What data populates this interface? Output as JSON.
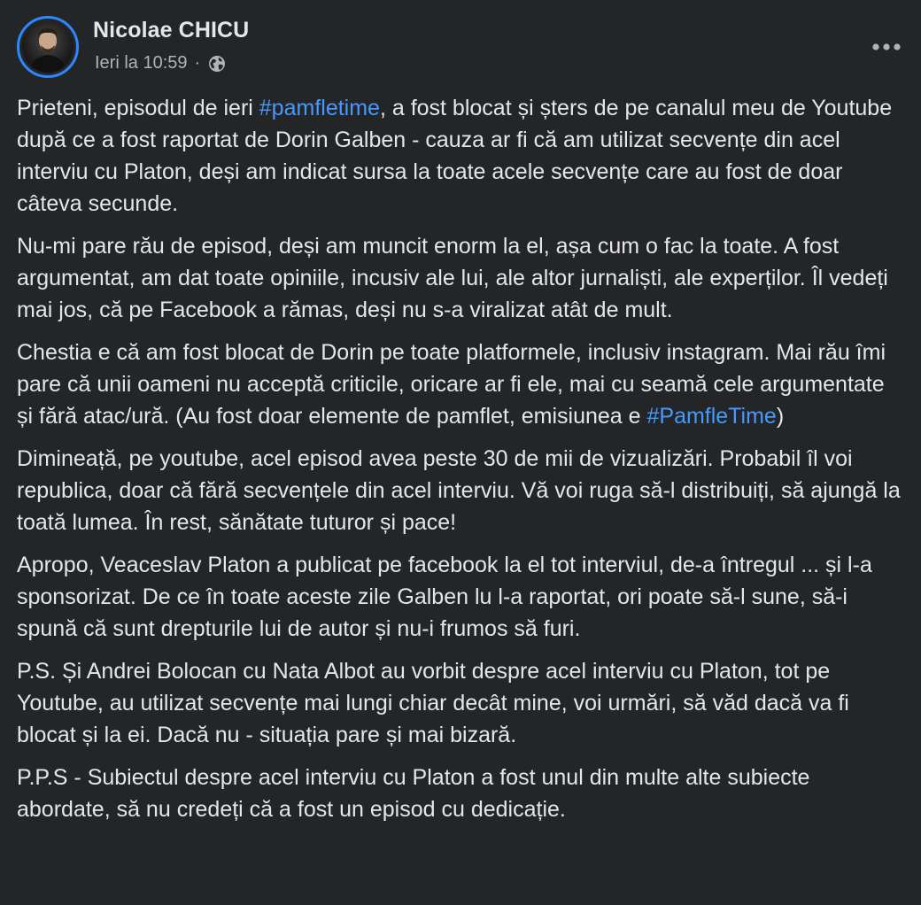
{
  "author": {
    "name": "Nicolae CHICU",
    "timestamp": "Ieri la 10:59",
    "separator": "·",
    "privacy_icon": "globe-icon"
  },
  "more_icon": "more-horizontal-icon",
  "colors": {
    "background": "#242526",
    "text": "#e4e6eb",
    "secondary_text": "#b0b3b8",
    "link": "#4599ff",
    "avatar_ring": "#2d88ff"
  },
  "paragraphs": [
    {
      "before": "Prieteni, episodul de ieri ",
      "hashtag": "#pamfletime",
      "after": ", a fost blocat și șters de pe canalul meu de Youtube după ce a fost raportat de Dorin Galben - cauza ar fi că am utilizat secvențe din acel interviu cu Platon, deși am indicat sursa la toate acele secvențe care au fost de doar câteva secunde."
    },
    {
      "text": "Nu-mi pare rău de episod, deși am muncit enorm la el, așa cum o fac la toate. A fost argumentat, am dat toate opiniile, incusiv ale lui, ale altor jurnaliști, ale experților. Îl vedeți mai jos, că pe Facebook a rămas, deși nu s-a viralizat atât de mult."
    },
    {
      "before": "Chestia e că am fost blocat de Dorin pe toate platformele, inclusiv instagram. Mai rău îmi pare că unii oameni nu acceptă criticile, oricare ar fi ele, mai cu seamă cele argumentate și fără atac/ură. (Au fost doar elemente de pamflet, emisiunea e ",
      "hashtag": "#PamfleTime",
      "after": ")"
    },
    {
      "text": "Dimineață, pe youtube, acel episod avea peste 30 de mii de vizualizări. Probabil îl voi republica, doar că fără secvențele din acel interviu. Vă voi ruga să-l distribuiți, să ajungă la toată lumea.  În rest, sănătate tuturor și pace!"
    },
    {
      "text": "Apropo, Veaceslav Platon a publicat pe facebook la el tot interviul, de-a întregul ... și l-a sponsorizat. De ce în toate aceste zile Galben lu l-a raportat, ori poate să-l sune, să-i spună că sunt drepturile lui de autor și nu-i frumos să furi."
    },
    {
      "text": "P.S. Și Andrei Bolocan cu Nata Albot au vorbit despre acel interviu cu Platon, tot pe Youtube, au utilizat secvențe mai lungi chiar decât mine, voi urmări, să văd dacă va fi blocat și la ei. Dacă nu - situația pare și mai bizară."
    },
    {
      "text": "P.P.S - Subiectul despre acel interviu cu Platon a fost unul din multe alte subiecte abordate, să nu credeți că a fost un episod cu dedicație."
    }
  ]
}
